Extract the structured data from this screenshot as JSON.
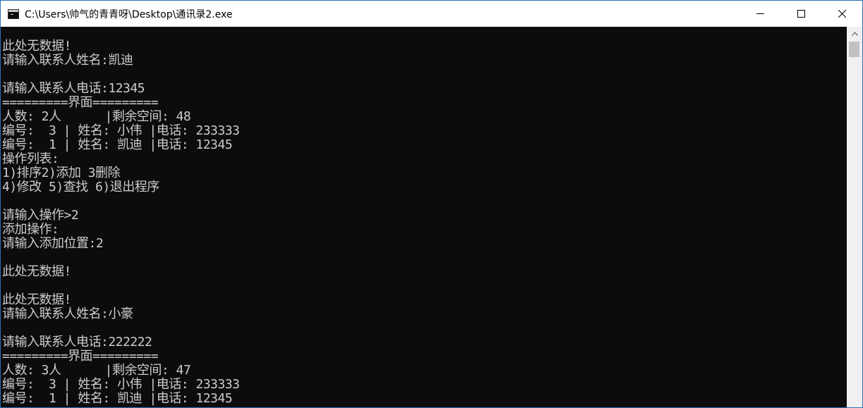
{
  "window": {
    "title": "C:\\Users\\帅气的青青呀\\Desktop\\通讯录2.exe",
    "icons": {
      "app": "console-app-icon",
      "minimize": "minimize-icon",
      "maximize": "maximize-icon",
      "close": "close-icon"
    }
  },
  "console": {
    "lines": [
      "此处无数据!",
      "请输入联系人姓名:凯迪",
      "",
      "请输入联系人电话:12345",
      "=========界面=========",
      "人数: 2人      |剩余空间: 48",
      "编号:  3 | 姓名: 小伟 |电话: 233333",
      "编号:  1 | 姓名: 凯迪 |电话: 12345",
      "操作列表:",
      "1)排序2)添加 3删除",
      "4)修改 5)查找 6)退出程序",
      "",
      "请输入操作>2",
      "添加操作:",
      "请输入添加位置:2",
      "",
      "此处无数据!",
      "",
      "此处无数据!",
      "请输入联系人姓名:小豪",
      "",
      "请输入联系人电话:222222",
      "=========界面=========",
      "人数: 3人      |剩余空间: 47",
      "编号:  3 | 姓名: 小伟 |电话: 233333",
      "编号:  1 | 姓名: 凯迪 |电话: 12345"
    ]
  },
  "scrollbar": {
    "up_icon": "scroll-up-arrow-icon",
    "position": 0.02
  }
}
